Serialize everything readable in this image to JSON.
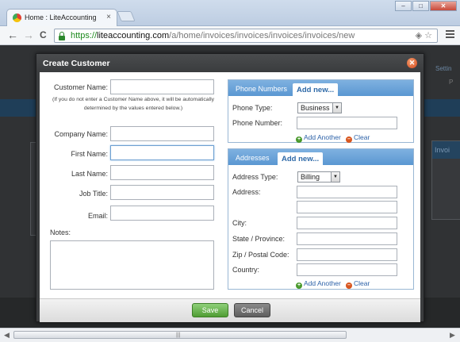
{
  "browser": {
    "tab_title": "Home : LiteAccounting",
    "tab_close": "×",
    "url_scheme": "https://",
    "url_host": "liteaccounting.com",
    "url_path": "/a/home/invoices/invoices/invoices/invoices/new",
    "back": "←",
    "forward": "→",
    "reload": "C",
    "addr_icons": "◈☆",
    "window_controls": {
      "minimize": "–",
      "maximize": "□",
      "close": "✕"
    }
  },
  "background_page": {
    "settings_text": "Settin",
    "p_text": "P",
    "invoice_panel_title": "Invoi"
  },
  "dialog": {
    "title": "Create Customer",
    "close": "✕",
    "fields": {
      "customer_name": {
        "label": "Customer Name:",
        "value": ""
      },
      "hint": "(If you do not enter a Customer Name above, it will be automatically determined by the values entered below.)",
      "company_name": {
        "label": "Company Name:",
        "value": ""
      },
      "first_name": {
        "label": "First Name:",
        "value": ""
      },
      "last_name": {
        "label": "Last Name:",
        "value": ""
      },
      "job_title": {
        "label": "Job Title:",
        "value": ""
      },
      "email": {
        "label": "Email:",
        "value": ""
      },
      "notes": {
        "label": "Notes:",
        "value": ""
      }
    },
    "phone_panel": {
      "title": "Phone Numbers",
      "add_tab": "Add new...",
      "phone_type_label": "Phone Type:",
      "phone_type_value": "Business",
      "phone_number_label": "Phone Number:",
      "add_another": "Add Another",
      "clear": "Clear"
    },
    "address_panel": {
      "title": "Addresses",
      "add_tab": "Add new...",
      "address_type_label": "Address Type:",
      "address_type_value": "Billing",
      "address_label": "Address:",
      "city_label": "City:",
      "state_label": "State / Province:",
      "zip_label": "Zip / Postal Code:",
      "country_label": "Country:",
      "add_another": "Add Another",
      "clear": "Clear"
    },
    "buttons": {
      "save": "Save",
      "cancel": "Cancel"
    }
  },
  "icons": [
    "favicon-icon",
    "lock-icon",
    "shield-icon",
    "star-icon",
    "menu-icon",
    "close-icon",
    "add-icon",
    "clear-icon",
    "dropdown-arrow-icon"
  ]
}
